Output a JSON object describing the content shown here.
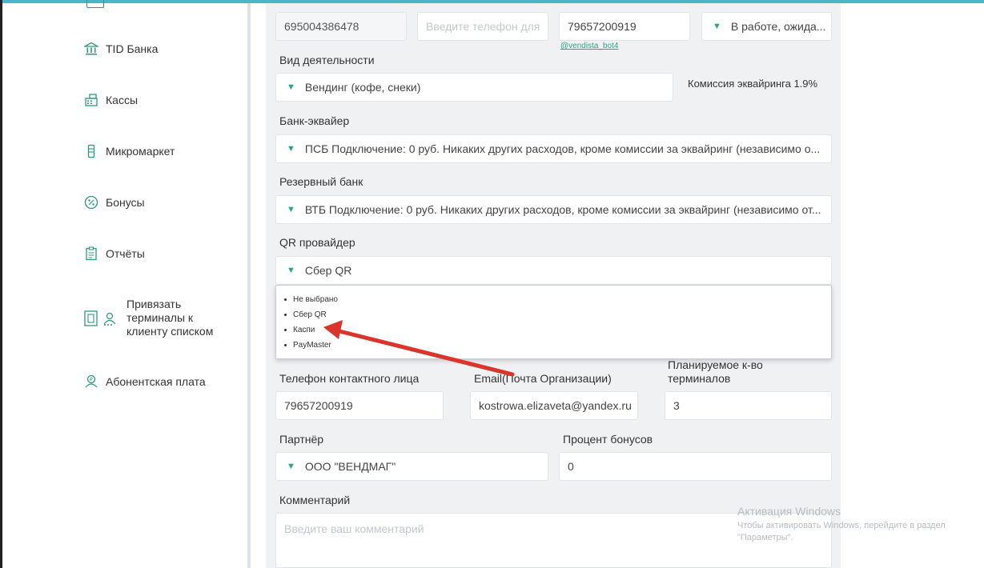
{
  "sidebar": {
    "items": [
      {
        "label": "TID Банка",
        "icon": "bank-icon"
      },
      {
        "label": "Кассы",
        "icon": "cash-register-icon"
      },
      {
        "label": "Микромаркет",
        "icon": "micromarket-icon"
      },
      {
        "label": "Бонусы",
        "icon": "percent-icon"
      },
      {
        "label": "Отчёты",
        "icon": "report-icon"
      },
      {
        "label": "Привязать терминалы к клиенту списком",
        "icon": "terminal-bind-icon"
      },
      {
        "label": "Абонентская плата",
        "icon": "subscription-icon"
      }
    ]
  },
  "form": {
    "inn_value": "695004386478",
    "whatsapp_placeholder": "Введите телефон для",
    "telegram_value": "79657200919",
    "bot_link": "@vendista_bot4",
    "status_value": "В работе, ожида...",
    "activity_label": "Вид деятельности",
    "activity_value": "Вендинг (кофе, снеки)",
    "commission_text": "Комиссия эквайринга 1.9%",
    "acquirer_label": "Банк-эквайер",
    "acquirer_value": "ПСБ Подключение: 0 руб. Никаких других расходов, кроме комиссии за эквайринг (независимо о...",
    "reserve_label": "Резервный банк",
    "reserve_value": "ВТБ Подключение: 0 руб. Никаких других расходов, кроме комиссии за эквайринг (независимо от...",
    "qr_label": "QR провайдер",
    "qr_value": "Сбер QR",
    "qr_options": [
      "Не выбрано",
      "Сбер QR",
      "Каспи",
      "PayMaster"
    ],
    "contact_phone_label": "Телефон контактного лица",
    "contact_phone_value": "79657200919",
    "email_label": "Email(Почта Организации)",
    "email_value": "kostrowa.elizaveta@yandex.ru",
    "terminals_label": "Планируемое к-во терминалов",
    "terminals_value": "3",
    "partner_label": "Партнёр",
    "partner_value": "ООО \"ВЕНДМАГ\"",
    "bonus_label": "Процент бонусов",
    "bonus_value": "0",
    "comment_label": "Комментарий",
    "comment_placeholder": "Введите ваш комментарий"
  },
  "watermark": {
    "title": "Активация Windows",
    "subtitle": "Чтобы активировать Windows, перейдите в раздел \"Параметры\"."
  },
  "colors": {
    "accent": "#27a584",
    "top_bar": "#4ab6c8",
    "panel_bg": "#f0f1f3",
    "arrow": "#d9352b"
  }
}
